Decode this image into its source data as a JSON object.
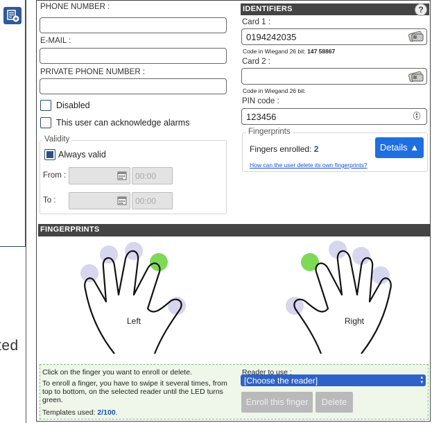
{
  "background": {
    "truncated_text": "ted"
  },
  "contact": {
    "phone_label": "PHONE NUMBER :",
    "phone_value": "",
    "email_label": "E-MAIL :",
    "email_value": "",
    "private_phone_label": "PRIVATE PHONE NUMBER :",
    "private_phone_value": "",
    "disabled_label": "Disabled",
    "disabled_checked": false,
    "ack_label": "This user can acknowledge alarms",
    "ack_checked": false
  },
  "validity": {
    "legend": "Validity",
    "always_valid_label": "Always valid",
    "always_valid_checked": true,
    "from_label": "From :",
    "from_time": "00:00",
    "to_label": "To :",
    "to_time": "00:00"
  },
  "identifiers": {
    "title": "Identifiers",
    "help": "?",
    "card1_label": "Card 1 :",
    "card1_value": "0194242035",
    "card1_wiegand_label": "Code in Wiegand 26 bit:",
    "card1_wiegand_value": "147 58867",
    "card2_label": "Card 2 :",
    "card2_value": "",
    "card2_wiegand_label": "Code in Wiegand 26 bit:",
    "pin_label": "PIN code :",
    "pin_value": "123456"
  },
  "fingerprints_box": {
    "legend": "Fingerprints",
    "enrolled_label": "Fingers enrolled:",
    "enrolled_count": "2",
    "details_button": "Details ▲",
    "help_link": "How can the user delete its own fingerprints?"
  },
  "fingerprints_section": {
    "title": "Fingerprints",
    "left_hand_label": "Left",
    "right_hand_label": "Right",
    "enrolled_color": "#7ed957",
    "available_color": "#d6d6ef"
  },
  "footer": {
    "instruction1": "Click on the finger you want to enroll or delete.",
    "instruction2": "To enroll a finger, you have to swipe it several times, from top to bottom, on the selected reader until the LED turns green.",
    "templates_label": "Templates used:",
    "templates_value": "2/100",
    "reader_label": "Reader to use :",
    "reader_selected": "[Choose the reader]",
    "enroll_button": "Enroll this finger",
    "delete_button": "Delete"
  }
}
